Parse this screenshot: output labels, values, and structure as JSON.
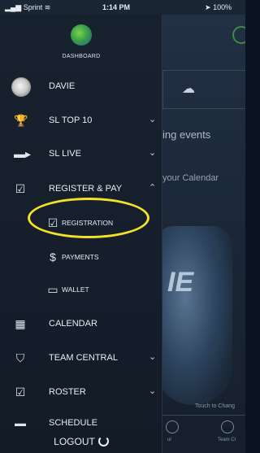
{
  "status_bar": {
    "carrier": "Sprint",
    "time": "1:14 PM",
    "battery": "100%"
  },
  "drawer": {
    "header_label": "DASHBOARD",
    "items": [
      {
        "label": "DAVIE",
        "icon": "avatar"
      },
      {
        "label": "SL TOP 10",
        "icon": "trophy-icon"
      },
      {
        "label": "SL LIVE",
        "icon": "video-icon"
      },
      {
        "label": "REGISTER & PAY",
        "icon": "checklist-icon"
      },
      {
        "label": "REGISTRATION",
        "icon": "checklist-icon"
      },
      {
        "label": "PAYMENTS",
        "icon": "dollar-icon"
      },
      {
        "label": "WALLET",
        "icon": "card-icon"
      },
      {
        "label": "CALENDAR",
        "icon": "calendar-icon"
      },
      {
        "label": "TEAM CENTRAL",
        "icon": "shield-icon"
      },
      {
        "label": "ROSTER",
        "icon": "checklist-icon"
      },
      {
        "label": "SCHEDULE",
        "icon": "schedule-icon"
      }
    ],
    "logout_label": "LOGOUT"
  },
  "background": {
    "events_text": "ing events",
    "calendar_text": "your Calendar",
    "touch_text": "Touch to Chang",
    "bottom_labels": [
      "ul",
      "Team Cl"
    ]
  },
  "colors": {
    "highlight": "#f2e22a",
    "drawer_bg": "#131b27",
    "logo_green": "#3aa04a"
  }
}
